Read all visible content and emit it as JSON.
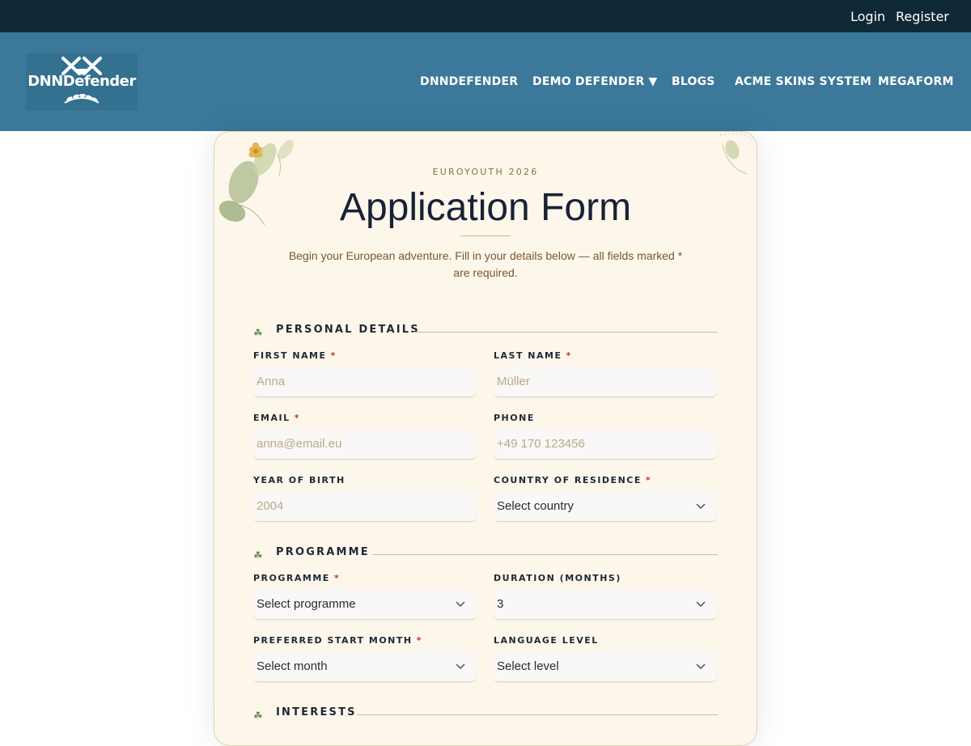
{
  "topbar": {
    "login": "Login",
    "register": "Register"
  },
  "logo": {
    "text": "DNNDefender"
  },
  "nav": [
    {
      "label": "DNNDEFENDER"
    },
    {
      "label": "DEMO DEFENDER ▼"
    },
    {
      "label": "BLOGS"
    },
    {
      "label": "ACME SKINS SYSTEM"
    },
    {
      "label": "MEGAFORM"
    }
  ],
  "form": {
    "eyebrow": "EUROYOUTH 2026",
    "title": "Application Form",
    "subtitle": "Begin your European adventure. Fill in your details below — all fields marked * are required.",
    "required_mark": "*",
    "sections": {
      "personal": "PERSONAL DETAILS",
      "programme": "PROGRAMME",
      "interests": "INTERESTS"
    },
    "fields": {
      "first_name": {
        "label": "FIRST NAME",
        "placeholder": "Anna"
      },
      "last_name": {
        "label": "LAST NAME",
        "placeholder": "Müller"
      },
      "email": {
        "label": "EMAIL",
        "placeholder": "anna@email.eu"
      },
      "phone": {
        "label": "PHONE",
        "placeholder": "+49 170 123456"
      },
      "year_of_birth": {
        "label": "YEAR OF BIRTH",
        "placeholder": "2004"
      },
      "country": {
        "label": "COUNTRY OF RESIDENCE",
        "value": "Select country"
      },
      "programme": {
        "label": "PROGRAMME",
        "value": "Select programme"
      },
      "duration": {
        "label": "DURATION (MONTHS)",
        "value": "3"
      },
      "start_month": {
        "label": "PREFERRED START MONTH",
        "value": "Select month"
      },
      "language_level": {
        "label": "LANGUAGE LEVEL",
        "value": "Select level"
      }
    }
  },
  "icons": {
    "section_marker": "clover-icon",
    "select_arrow": "chevron-down-icon"
  },
  "colors": {
    "topbar": "#0f2836",
    "header": "#3b7899",
    "card_bg": "#fcf7ea",
    "title": "#182236",
    "required": "#c0392b"
  }
}
